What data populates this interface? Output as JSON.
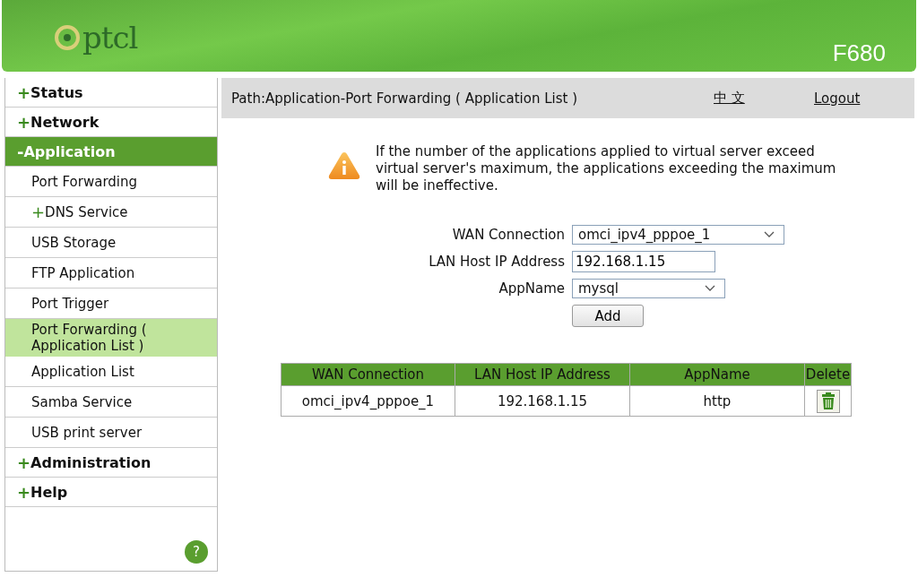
{
  "header": {
    "logo": "ptcl",
    "model": "F680"
  },
  "sidebar": {
    "items": [
      {
        "marker": "+",
        "label": "Status",
        "selected": false
      },
      {
        "marker": "+",
        "label": "Network",
        "selected": false
      },
      {
        "marker": "-",
        "label": "Application",
        "selected": true,
        "children": [
          {
            "label": "Port Forwarding",
            "selected": false
          },
          {
            "marker": "+",
            "label": "DNS Service",
            "selected": false
          },
          {
            "label": "USB Storage",
            "selected": false
          },
          {
            "label": "FTP Application",
            "selected": false
          },
          {
            "label": "Port Trigger",
            "selected": false
          },
          {
            "label": "Port Forwarding ( Application List )",
            "selected": true
          },
          {
            "label": "Application List",
            "selected": false
          },
          {
            "label": "Samba Service",
            "selected": false
          },
          {
            "label": "USB print server",
            "selected": false
          }
        ]
      },
      {
        "marker": "+",
        "label": "Administration",
        "selected": false
      },
      {
        "marker": "+",
        "label": "Help",
        "selected": false
      }
    ],
    "help_button": "?"
  },
  "path_bar": {
    "path": "Path:Application-Port Forwarding ( Application List )",
    "language_link": "中 文",
    "logout_link": "Logout"
  },
  "notice": "If the number of the applications applied to virtual server exceed virtual server's maximum, the applications exceeding the maximum will be ineffective.",
  "form": {
    "fields": [
      {
        "kind": "select",
        "label": "WAN Connection",
        "value": "omci_ipv4_pppoe_1"
      },
      {
        "kind": "input",
        "label": "LAN Host IP Address",
        "value": "192.168.1.15"
      },
      {
        "kind": "select",
        "label": "AppName",
        "value": "mysql"
      }
    ],
    "add_button": "Add"
  },
  "table": {
    "columns": [
      "WAN Connection",
      "LAN Host IP Address",
      "AppName",
      "Delete"
    ],
    "rows": [
      {
        "cells": [
          "omci_ipv4_pppoe_1",
          "192.168.1.15",
          "http"
        ]
      }
    ]
  }
}
